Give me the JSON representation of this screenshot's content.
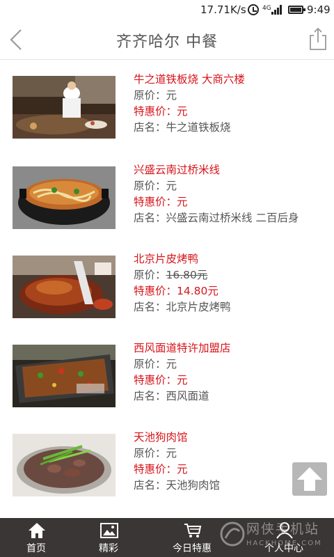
{
  "status_bar": {
    "net_speed": "17.71K/s",
    "network_type": "4G",
    "time": "9:49"
  },
  "header": {
    "title": "齐齐哈尔 中餐",
    "back_icon": "chevron-left-icon",
    "share_icon": "share-icon"
  },
  "labels": {
    "original_price": "原价：",
    "special_price": "特惠价：",
    "shop_name": "店名："
  },
  "deals": [
    {
      "name": "牛之道铁板烧 大商六楼",
      "original_price": "元",
      "special_price": "元",
      "shop": "牛之道铁板烧",
      "image": "teppanyaki-chef-photo"
    },
    {
      "name": "兴盛云南过桥米线",
      "original_price": "元",
      "special_price": "元",
      "shop": "兴盛云南过桥米线 二百后身",
      "image": "rice-noodle-pot-photo"
    },
    {
      "name": "北京片皮烤鸭",
      "original_price": "16.80元",
      "special_price": "14.80元",
      "shop": "北京片皮烤鸭",
      "image": "roast-duck-photo"
    },
    {
      "name": "西风面道特许加盟店",
      "original_price": "元",
      "special_price": "元",
      "shop": "西风面道",
      "image": "grilled-fish-photo"
    },
    {
      "name": "天池狗肉馆",
      "original_price": "元",
      "special_price": "元",
      "shop": "天池狗肉馆",
      "image": "meat-plate-photo"
    }
  ],
  "bottom_nav": [
    {
      "label": "首页",
      "icon": "home-icon"
    },
    {
      "label": "精彩",
      "icon": "picture-icon"
    },
    {
      "label": "今日特惠",
      "icon": "cart-icon"
    },
    {
      "label": "个人中心",
      "icon": "user-icon"
    }
  ],
  "watermark": {
    "text": "网侠手机站",
    "url": "HACKHOME.COM"
  },
  "colors": {
    "accent_red": "#d8141b",
    "nav_bg": "#3a3636",
    "text_gray": "#555555"
  }
}
